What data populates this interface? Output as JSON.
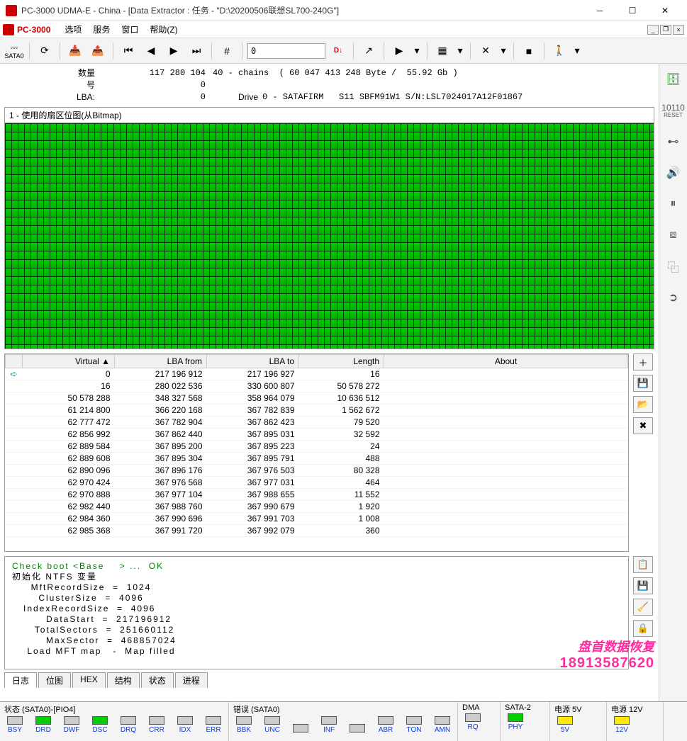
{
  "window": {
    "title": "PC-3000 UDMA-E - China - [Data Extractor : 任务 - \"D:\\20200506联想SL700-240G\"]"
  },
  "menubar": {
    "app": "PC-3000",
    "items": [
      "选项",
      "服务",
      "窗口",
      "帮助(Z)"
    ]
  },
  "toolbar": {
    "sata_label": "SATA0",
    "jump_input": "0",
    "jump_suffix": "D↓"
  },
  "right_sidebar": {
    "reset_label": "RESET"
  },
  "info": {
    "qty_label": "数量",
    "qty_value": "117 280 104",
    "qty_extra": "40 - chains  ( 60 047 413 248 Byte /  55.92 Gb )",
    "num_label": "号",
    "num_value": "0",
    "lba_label": "LBA:",
    "lba_value": "0",
    "drive_label": "Drive",
    "drive_value": "0 - SATAFIRM   S11 SBFM91W1 S/N:LSL7024017A12F01867"
  },
  "bitmap": {
    "title": "1 - 使用的扇区位图(从Bitmap)"
  },
  "table": {
    "headers": [
      "Virtual ▲",
      "LBA from",
      "LBA to",
      "Length",
      "About"
    ],
    "rows": [
      [
        "0",
        "217 196 912",
        "217 196 927",
        "16",
        ""
      ],
      [
        "16",
        "280 022 536",
        "330 600 807",
        "50 578 272",
        ""
      ],
      [
        "50 578 288",
        "348 327 568",
        "358 964 079",
        "10 636 512",
        ""
      ],
      [
        "61 214 800",
        "366 220 168",
        "367 782 839",
        "1 562 672",
        ""
      ],
      [
        "62 777 472",
        "367 782 904",
        "367 862 423",
        "79 520",
        ""
      ],
      [
        "62 856 992",
        "367 862 440",
        "367 895 031",
        "32 592",
        ""
      ],
      [
        "62 889 584",
        "367 895 200",
        "367 895 223",
        "24",
        ""
      ],
      [
        "62 889 608",
        "367 895 304",
        "367 895 791",
        "488",
        ""
      ],
      [
        "62 890 096",
        "367 896 176",
        "367 976 503",
        "80 328",
        ""
      ],
      [
        "62 970 424",
        "367 976 568",
        "367 977 031",
        "464",
        ""
      ],
      [
        "62 970 888",
        "367 977 104",
        "367 988 655",
        "11 552",
        ""
      ],
      [
        "62 982 440",
        "367 988 760",
        "367 990 679",
        "1 920",
        ""
      ],
      [
        "62 984 360",
        "367 990 696",
        "367 991 703",
        "1 008",
        ""
      ],
      [
        "62 985 368",
        "367 991 720",
        "367 992 079",
        "360",
        ""
      ]
    ]
  },
  "log": {
    "line_ok": "Check boot <Base    > ...  OK",
    "lines": [
      "初始化 NTFS 变量",
      "     MftRecordSize  =  1024",
      "       ClusterSize  =  4096",
      "   IndexRecordSize  =  4096",
      "         DataStart  =  217196912",
      "      TotalSectors  =  251660112",
      "         MaxSector  =  468857024",
      "    Load MFT map   -  Map filled"
    ]
  },
  "tabs": {
    "items": [
      "日志",
      "位图",
      "HEX",
      "结构",
      "状态",
      "进程"
    ],
    "active": 0
  },
  "status": {
    "group1_title": "状态 (SATA0)-[PIO4]",
    "group1_leds": [
      {
        "name": "BSY",
        "on": false
      },
      {
        "name": "DRD",
        "on": true
      },
      {
        "name": "DWF",
        "on": false
      },
      {
        "name": "DSC",
        "on": true
      },
      {
        "name": "DRQ",
        "on": false
      },
      {
        "name": "CRR",
        "on": false
      },
      {
        "name": "IDX",
        "on": false
      },
      {
        "name": "ERR",
        "on": false
      }
    ],
    "group2_title": "错误 (SATA0)",
    "group2_leds": [
      {
        "name": "BBK",
        "on": false
      },
      {
        "name": "UNC",
        "on": false
      },
      {
        "name": "",
        "on": false
      },
      {
        "name": "INF",
        "on": false
      },
      {
        "name": "",
        "on": false
      },
      {
        "name": "ABR",
        "on": false
      },
      {
        "name": "TON",
        "on": false
      },
      {
        "name": "AMN",
        "on": false
      }
    ],
    "group3_title": "DMA",
    "group3_leds": [
      {
        "name": "RQ",
        "on": false
      }
    ],
    "group4_title": "SATA-2",
    "group4_leds": [
      {
        "name": "PHY",
        "on": true
      }
    ],
    "group5_title": "电源 5V",
    "group5_leds": [
      {
        "name": "5V",
        "on": "yellow"
      }
    ],
    "group6_title": "电源 12V",
    "group6_leds": [
      {
        "name": "12V",
        "on": "yellow"
      }
    ]
  },
  "watermark": {
    "l1": "盘首数据恢复",
    "l2": "18913587620"
  }
}
